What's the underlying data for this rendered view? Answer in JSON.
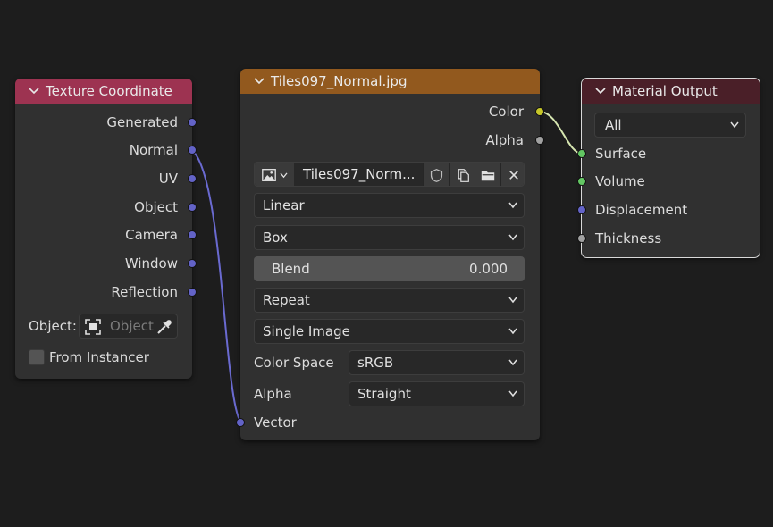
{
  "nodes": {
    "texture_coordinate": {
      "title": "Texture Coordinate",
      "outputs": [
        "Generated",
        "Normal",
        "UV",
        "Object",
        "Camera",
        "Window",
        "Reflection"
      ],
      "object_label": "Object:",
      "object_placeholder": "Object",
      "from_instancer_label": "From Instancer",
      "from_instancer_checked": false
    },
    "image_texture": {
      "title": "Tiles097_Normal.jpg",
      "outputs": [
        "Color",
        "Alpha"
      ],
      "image_name": "Tiles097_Norm...",
      "interpolation": "Linear",
      "projection": "Box",
      "blend_label": "Blend",
      "blend_value": "0.000",
      "extension": "Repeat",
      "source": "Single Image",
      "color_space_label": "Color Space",
      "color_space_value": "sRGB",
      "alpha_label": "Alpha",
      "alpha_value": "Straight",
      "input_vector": "Vector"
    },
    "material_output": {
      "title": "Material Output",
      "target": "All",
      "inputs": [
        "Surface",
        "Volume",
        "Displacement",
        "Thickness"
      ]
    }
  },
  "colors": {
    "texture_coordinate_header": "#9d3351",
    "image_texture_header": "#92591e",
    "material_output_header": "#4a1f28",
    "vector_socket": "#6363c7",
    "color_socket": "#c7c729",
    "float_socket": "#a1a1a1",
    "shader_socket": "#63c763"
  }
}
